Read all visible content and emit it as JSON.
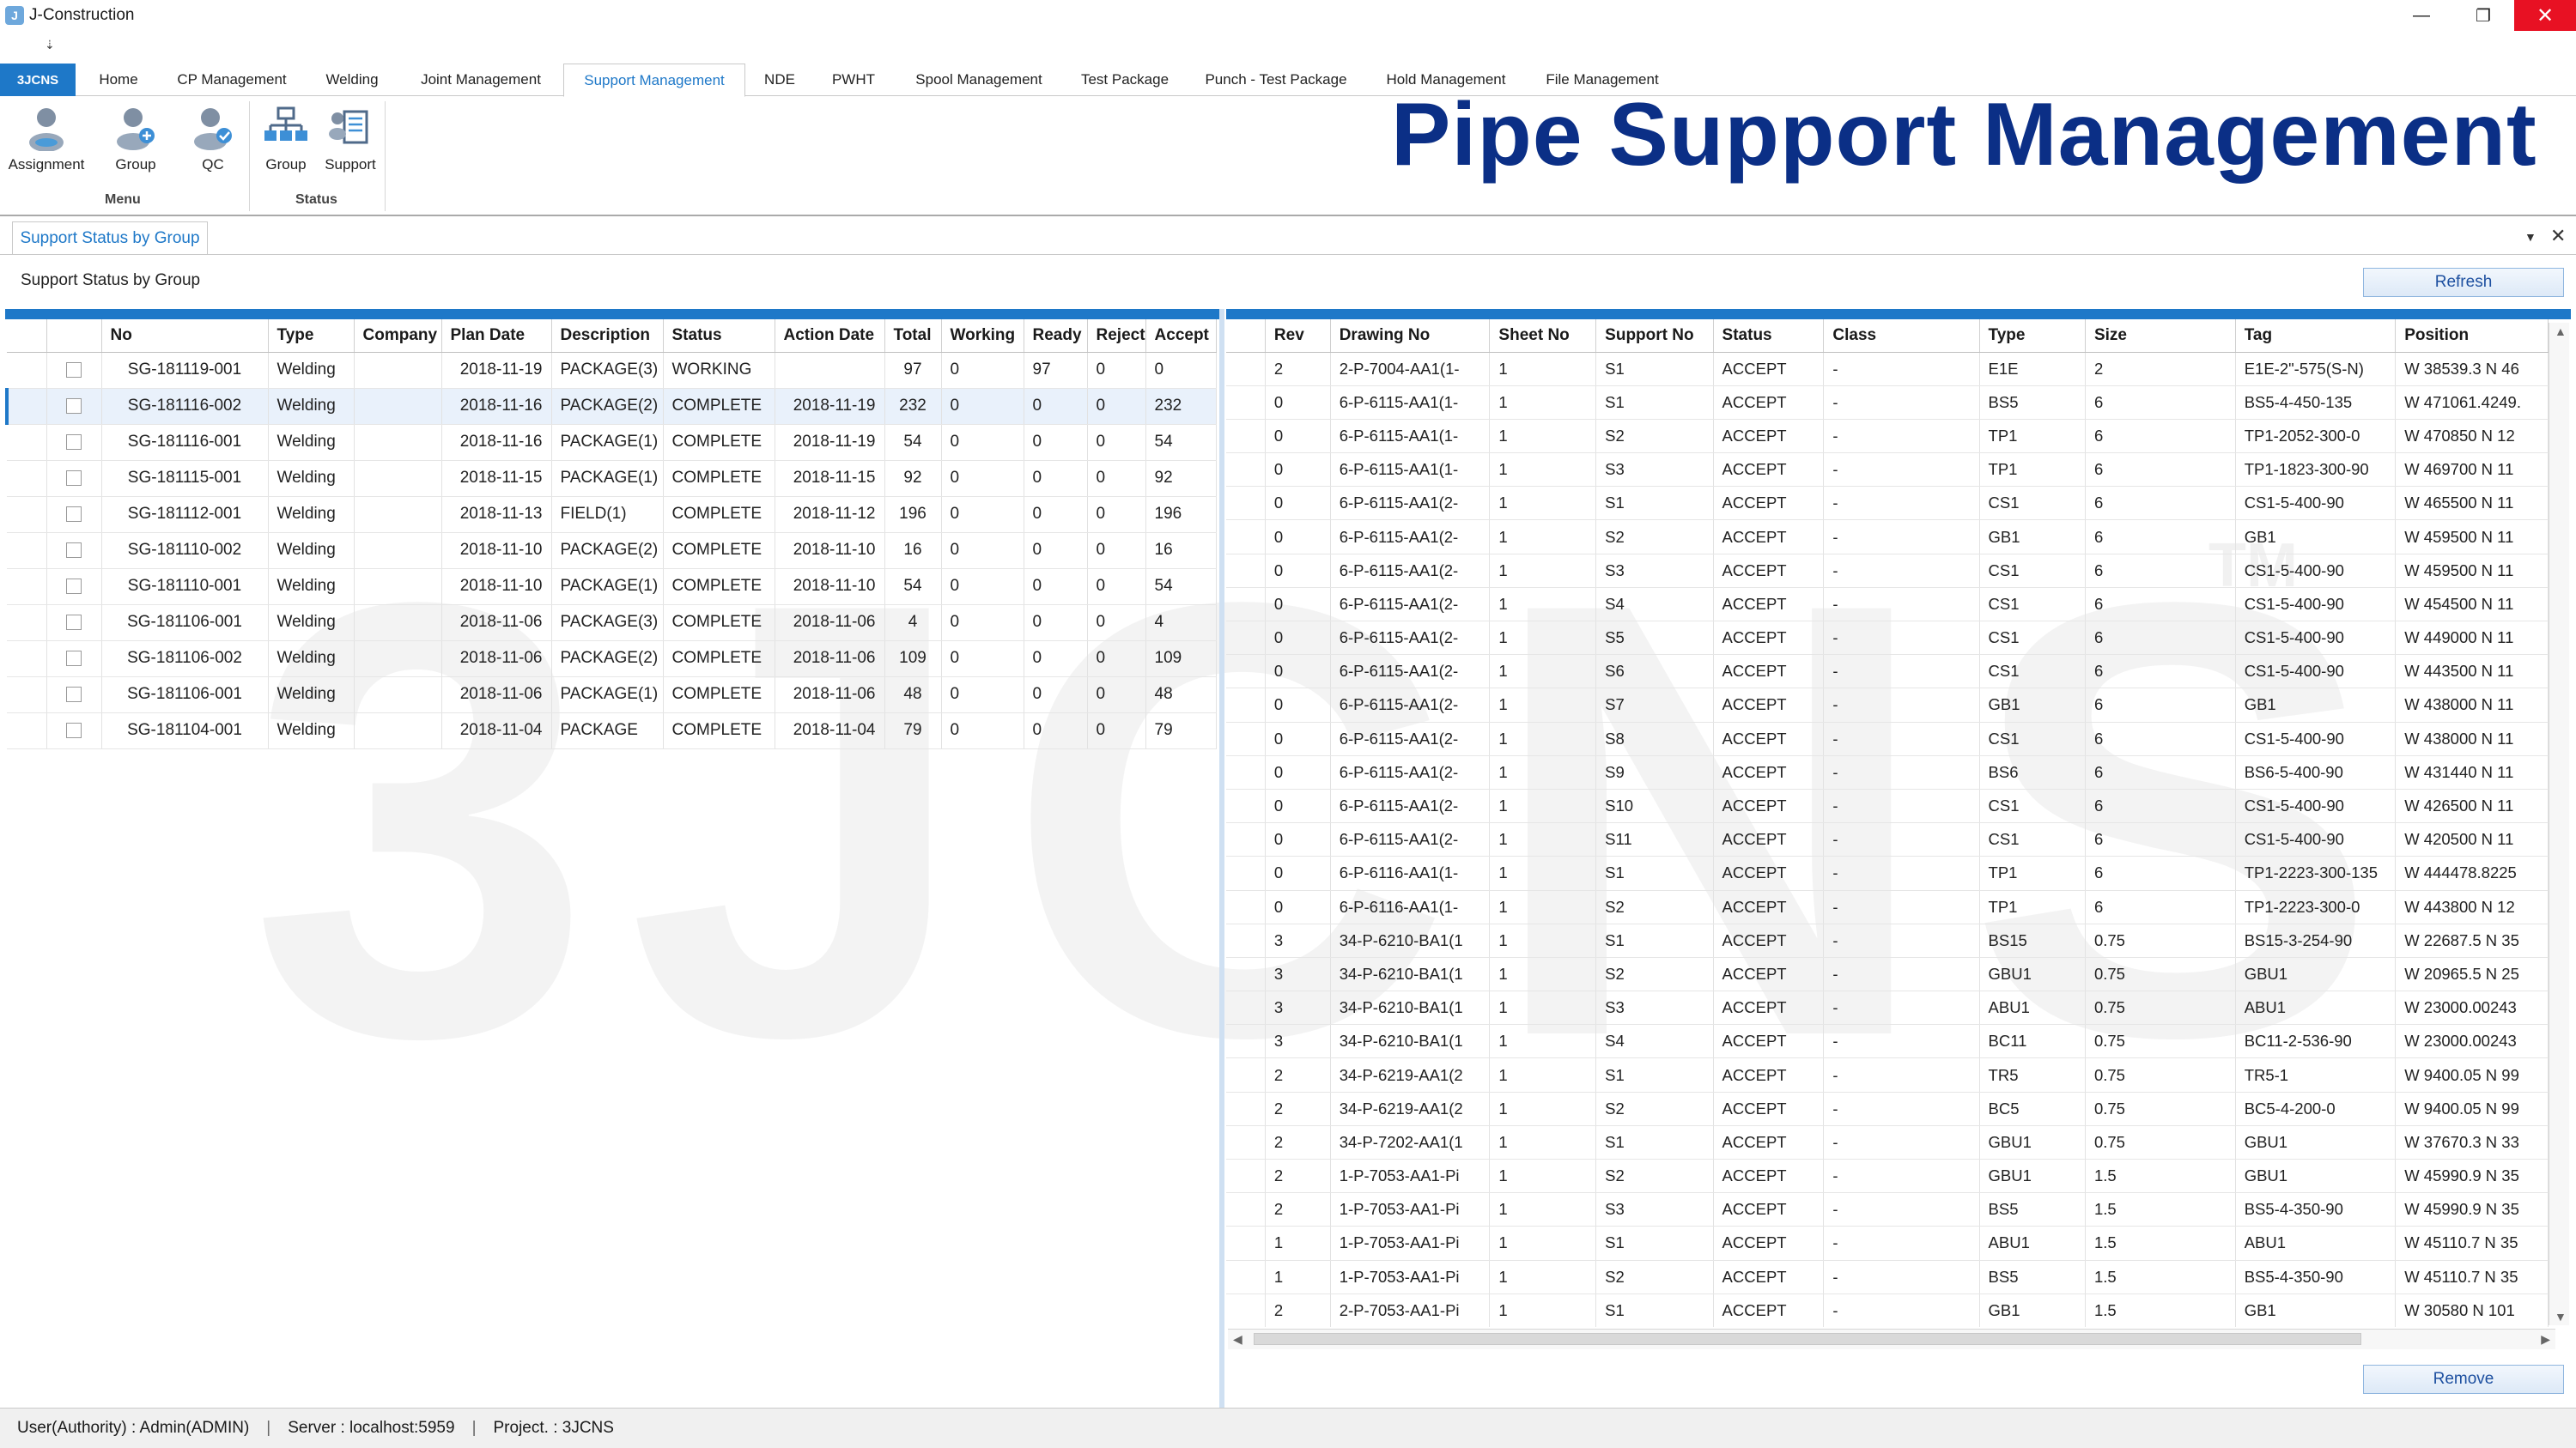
{
  "window": {
    "title": "J-Construction",
    "icon": "app-logo-icon",
    "qat_symbol": "⇣"
  },
  "ribbon_tabs": [
    {
      "label": "3JCNS"
    },
    {
      "label": "Home"
    },
    {
      "label": "CP Management"
    },
    {
      "label": "Welding"
    },
    {
      "label": "Joint Management"
    },
    {
      "label": "Support Management"
    },
    {
      "label": "NDE"
    },
    {
      "label": "PWHT"
    },
    {
      "label": "Spool Management"
    },
    {
      "label": "Test Package"
    },
    {
      "label": "Punch - Test Package"
    },
    {
      "label": "Hold Management"
    },
    {
      "label": "File Management"
    }
  ],
  "ribbon": {
    "buttons": [
      {
        "label": "Assignment",
        "icon": "user-assignment-icon"
      },
      {
        "label": "Group",
        "icon": "user-group-icon"
      },
      {
        "label": "QC",
        "icon": "user-qc-icon"
      },
      {
        "label": "Group",
        "icon": "org-chart-icon"
      },
      {
        "label": "Support",
        "icon": "support-list-icon"
      }
    ],
    "groups": {
      "menu": "Menu",
      "status": "Status"
    }
  },
  "banner": {
    "title": "Pipe Support Management"
  },
  "watermark": {
    "text": "3JCNS",
    "trademark": "TM"
  },
  "doc_tab": {
    "label": "Support Status by Group"
  },
  "section_label": "Support Status by Group",
  "buttons": {
    "refresh": "Refresh",
    "remove": "Remove"
  },
  "left_grid": {
    "columns": [
      "No",
      "Type",
      "Company",
      "Plan Date",
      "Description",
      "Status",
      "Action Date",
      "Total",
      "Working",
      "Ready",
      "Reject",
      "Accept"
    ],
    "rows": [
      {
        "no": "SG-181119-001",
        "type": "Welding",
        "company": "",
        "plan_date": "2018-11-19",
        "desc": "PACKAGE(3)",
        "status": "WORKING",
        "action_date": "",
        "total": "97",
        "working": "0",
        "ready": "97",
        "reject": "0",
        "accept": "0"
      },
      {
        "no": "SG-181116-002",
        "type": "Welding",
        "company": "",
        "plan_date": "2018-11-16",
        "desc": "PACKAGE(2)",
        "status": "COMPLETE",
        "action_date": "2018-11-19",
        "total": "232",
        "working": "0",
        "ready": "0",
        "reject": "0",
        "accept": "232"
      },
      {
        "no": "SG-181116-001",
        "type": "Welding",
        "company": "",
        "plan_date": "2018-11-16",
        "desc": "PACKAGE(1)",
        "status": "COMPLETE",
        "action_date": "2018-11-19",
        "total": "54",
        "working": "0",
        "ready": "0",
        "reject": "0",
        "accept": "54"
      },
      {
        "no": "SG-181115-001",
        "type": "Welding",
        "company": "",
        "plan_date": "2018-11-15",
        "desc": "PACKAGE(1)",
        "status": "COMPLETE",
        "action_date": "2018-11-15",
        "total": "92",
        "working": "0",
        "ready": "0",
        "reject": "0",
        "accept": "92"
      },
      {
        "no": "SG-181112-001",
        "type": "Welding",
        "company": "",
        "plan_date": "2018-11-13",
        "desc": "FIELD(1)",
        "status": "COMPLETE",
        "action_date": "2018-11-12",
        "total": "196",
        "working": "0",
        "ready": "0",
        "reject": "0",
        "accept": "196"
      },
      {
        "no": "SG-181110-002",
        "type": "Welding",
        "company": "",
        "plan_date": "2018-11-10",
        "desc": "PACKAGE(2)",
        "status": "COMPLETE",
        "action_date": "2018-11-10",
        "total": "16",
        "working": "0",
        "ready": "0",
        "reject": "0",
        "accept": "16"
      },
      {
        "no": "SG-181110-001",
        "type": "Welding",
        "company": "",
        "plan_date": "2018-11-10",
        "desc": "PACKAGE(1)",
        "status": "COMPLETE",
        "action_date": "2018-11-10",
        "total": "54",
        "working": "0",
        "ready": "0",
        "reject": "0",
        "accept": "54"
      },
      {
        "no": "SG-181106-001",
        "type": "Welding",
        "company": "",
        "plan_date": "2018-11-06",
        "desc": "PACKAGE(3)",
        "status": "COMPLETE",
        "action_date": "2018-11-06",
        "total": "4",
        "working": "0",
        "ready": "0",
        "reject": "0",
        "accept": "4"
      },
      {
        "no": "SG-181106-002",
        "type": "Welding",
        "company": "",
        "plan_date": "2018-11-06",
        "desc": "PACKAGE(2)",
        "status": "COMPLETE",
        "action_date": "2018-11-06",
        "total": "109",
        "working": "0",
        "ready": "0",
        "reject": "0",
        "accept": "109"
      },
      {
        "no": "SG-181106-001",
        "type": "Welding",
        "company": "",
        "plan_date": "2018-11-06",
        "desc": "PACKAGE(1)",
        "status": "COMPLETE",
        "action_date": "2018-11-06",
        "total": "48",
        "working": "0",
        "ready": "0",
        "reject": "0",
        "accept": "48"
      },
      {
        "no": "SG-181104-001",
        "type": "Welding",
        "company": "",
        "plan_date": "2018-11-04",
        "desc": "PACKAGE",
        "status": "COMPLETE",
        "action_date": "2018-11-04",
        "total": "79",
        "working": "0",
        "ready": "0",
        "reject": "0",
        "accept": "79"
      }
    ]
  },
  "right_grid": {
    "columns": [
      "Rev",
      "Drawing No",
      "Sheet No",
      "Support No",
      "Status",
      "Class",
      "Type",
      "Size",
      "Tag",
      "Position"
    ],
    "rows": [
      {
        "rev": "2",
        "drawing": "2-P-7004-AA1(1-",
        "sheet": "1",
        "support": "S1",
        "status": "ACCEPT",
        "class": "-",
        "type": "E1E",
        "size": "2",
        "tag": "E1E-2\"-575(S-N)",
        "pos": "W 38539.3 N 46"
      },
      {
        "rev": "0",
        "drawing": "6-P-6115-AA1(1-",
        "sheet": "1",
        "support": "S1",
        "status": "ACCEPT",
        "class": "-",
        "type": "BS5",
        "size": "6",
        "tag": "BS5-4-450-135",
        "pos": "W 471061.4249."
      },
      {
        "rev": "0",
        "drawing": "6-P-6115-AA1(1-",
        "sheet": "1",
        "support": "S2",
        "status": "ACCEPT",
        "class": "-",
        "type": "TP1",
        "size": "6",
        "tag": "TP1-2052-300-0",
        "pos": "W 470850 N 12"
      },
      {
        "rev": "0",
        "drawing": "6-P-6115-AA1(1-",
        "sheet": "1",
        "support": "S3",
        "status": "ACCEPT",
        "class": "-",
        "type": "TP1",
        "size": "6",
        "tag": "TP1-1823-300-90",
        "pos": "W 469700 N 11"
      },
      {
        "rev": "0",
        "drawing": "6-P-6115-AA1(2-",
        "sheet": "1",
        "support": "S1",
        "status": "ACCEPT",
        "class": "-",
        "type": "CS1",
        "size": "6",
        "tag": "CS1-5-400-90",
        "pos": "W 465500 N 11"
      },
      {
        "rev": "0",
        "drawing": "6-P-6115-AA1(2-",
        "sheet": "1",
        "support": "S2",
        "status": "ACCEPT",
        "class": "-",
        "type": "GB1",
        "size": "6",
        "tag": "GB1",
        "pos": "W 459500 N 11"
      },
      {
        "rev": "0",
        "drawing": "6-P-6115-AA1(2-",
        "sheet": "1",
        "support": "S3",
        "status": "ACCEPT",
        "class": "-",
        "type": "CS1",
        "size": "6",
        "tag": "CS1-5-400-90",
        "pos": "W 459500 N 11"
      },
      {
        "rev": "0",
        "drawing": "6-P-6115-AA1(2-",
        "sheet": "1",
        "support": "S4",
        "status": "ACCEPT",
        "class": "-",
        "type": "CS1",
        "size": "6",
        "tag": "CS1-5-400-90",
        "pos": "W 454500 N 11"
      },
      {
        "rev": "0",
        "drawing": "6-P-6115-AA1(2-",
        "sheet": "1",
        "support": "S5",
        "status": "ACCEPT",
        "class": "-",
        "type": "CS1",
        "size": "6",
        "tag": "CS1-5-400-90",
        "pos": "W 449000 N 11"
      },
      {
        "rev": "0",
        "drawing": "6-P-6115-AA1(2-",
        "sheet": "1",
        "support": "S6",
        "status": "ACCEPT",
        "class": "-",
        "type": "CS1",
        "size": "6",
        "tag": "CS1-5-400-90",
        "pos": "W 443500 N 11"
      },
      {
        "rev": "0",
        "drawing": "6-P-6115-AA1(2-",
        "sheet": "1",
        "support": "S7",
        "status": "ACCEPT",
        "class": "-",
        "type": "GB1",
        "size": "6",
        "tag": "GB1",
        "pos": "W 438000 N 11"
      },
      {
        "rev": "0",
        "drawing": "6-P-6115-AA1(2-",
        "sheet": "1",
        "support": "S8",
        "status": "ACCEPT",
        "class": "-",
        "type": "CS1",
        "size": "6",
        "tag": "CS1-5-400-90",
        "pos": "W 438000 N 11"
      },
      {
        "rev": "0",
        "drawing": "6-P-6115-AA1(2-",
        "sheet": "1",
        "support": "S9",
        "status": "ACCEPT",
        "class": "-",
        "type": "BS6",
        "size": "6",
        "tag": "BS6-5-400-90",
        "pos": "W 431440 N 11"
      },
      {
        "rev": "0",
        "drawing": "6-P-6115-AA1(2-",
        "sheet": "1",
        "support": "S10",
        "status": "ACCEPT",
        "class": "-",
        "type": "CS1",
        "size": "6",
        "tag": "CS1-5-400-90",
        "pos": "W 426500 N 11"
      },
      {
        "rev": "0",
        "drawing": "6-P-6115-AA1(2-",
        "sheet": "1",
        "support": "S11",
        "status": "ACCEPT",
        "class": "-",
        "type": "CS1",
        "size": "6",
        "tag": "CS1-5-400-90",
        "pos": "W 420500 N 11"
      },
      {
        "rev": "0",
        "drawing": "6-P-6116-AA1(1-",
        "sheet": "1",
        "support": "S1",
        "status": "ACCEPT",
        "class": "-",
        "type": "TP1",
        "size": "6",
        "tag": "TP1-2223-300-135",
        "pos": "W 444478.8225"
      },
      {
        "rev": "0",
        "drawing": "6-P-6116-AA1(1-",
        "sheet": "1",
        "support": "S2",
        "status": "ACCEPT",
        "class": "-",
        "type": "TP1",
        "size": "6",
        "tag": "TP1-2223-300-0",
        "pos": "W 443800 N 12"
      },
      {
        "rev": "3",
        "drawing": "34-P-6210-BA1(1",
        "sheet": "1",
        "support": "S1",
        "status": "ACCEPT",
        "class": "-",
        "type": "BS15",
        "size": "0.75",
        "tag": "BS15-3-254-90",
        "pos": "W 22687.5 N 35"
      },
      {
        "rev": "3",
        "drawing": "34-P-6210-BA1(1",
        "sheet": "1",
        "support": "S2",
        "status": "ACCEPT",
        "class": "-",
        "type": "GBU1",
        "size": "0.75",
        "tag": "GBU1",
        "pos": "W 20965.5 N 25"
      },
      {
        "rev": "3",
        "drawing": "34-P-6210-BA1(1",
        "sheet": "1",
        "support": "S3",
        "status": "ACCEPT",
        "class": "-",
        "type": "ABU1",
        "size": "0.75",
        "tag": "ABU1",
        "pos": "W 23000.00243"
      },
      {
        "rev": "3",
        "drawing": "34-P-6210-BA1(1",
        "sheet": "1",
        "support": "S4",
        "status": "ACCEPT",
        "class": "-",
        "type": "BC11",
        "size": "0.75",
        "tag": "BC11-2-536-90",
        "pos": "W 23000.00243"
      },
      {
        "rev": "2",
        "drawing": "34-P-6219-AA1(2",
        "sheet": "1",
        "support": "S1",
        "status": "ACCEPT",
        "class": "-",
        "type": "TR5",
        "size": "0.75",
        "tag": "TR5-1",
        "pos": "W 9400.05 N 99"
      },
      {
        "rev": "2",
        "drawing": "34-P-6219-AA1(2",
        "sheet": "1",
        "support": "S2",
        "status": "ACCEPT",
        "class": "-",
        "type": "BC5",
        "size": "0.75",
        "tag": "BC5-4-200-0",
        "pos": "W 9400.05 N 99"
      },
      {
        "rev": "2",
        "drawing": "34-P-7202-AA1(1",
        "sheet": "1",
        "support": "S1",
        "status": "ACCEPT",
        "class": "-",
        "type": "GBU1",
        "size": "0.75",
        "tag": "GBU1",
        "pos": "W 37670.3 N 33"
      },
      {
        "rev": "2",
        "drawing": "1-P-7053-AA1-Pi",
        "sheet": "1",
        "support": "S2",
        "status": "ACCEPT",
        "class": "-",
        "type": "GBU1",
        "size": "1.5",
        "tag": "GBU1",
        "pos": "W 45990.9 N 35"
      },
      {
        "rev": "2",
        "drawing": "1-P-7053-AA1-Pi",
        "sheet": "1",
        "support": "S3",
        "status": "ACCEPT",
        "class": "-",
        "type": "BS5",
        "size": "1.5",
        "tag": "BS5-4-350-90",
        "pos": "W 45990.9 N 35"
      },
      {
        "rev": "1",
        "drawing": "1-P-7053-AA1-Pi",
        "sheet": "1",
        "support": "S1",
        "status": "ACCEPT",
        "class": "-",
        "type": "ABU1",
        "size": "1.5",
        "tag": "ABU1",
        "pos": "W 45110.7 N 35"
      },
      {
        "rev": "1",
        "drawing": "1-P-7053-AA1-Pi",
        "sheet": "1",
        "support": "S2",
        "status": "ACCEPT",
        "class": "-",
        "type": "BS5",
        "size": "1.5",
        "tag": "BS5-4-350-90",
        "pos": "W 45110.7 N 35"
      },
      {
        "rev": "2",
        "drawing": "2-P-7053-AA1-Pi",
        "sheet": "1",
        "support": "S1",
        "status": "ACCEPT",
        "class": "-",
        "type": "GB1",
        "size": "1.5",
        "tag": "GB1",
        "pos": "W 30580 N 101"
      }
    ]
  },
  "statusbar": {
    "user": "User(Authority) : Admin(ADMIN)",
    "server": "Server : localhost:5959",
    "project": "Project. : 3JCNS",
    "separator": "|"
  }
}
